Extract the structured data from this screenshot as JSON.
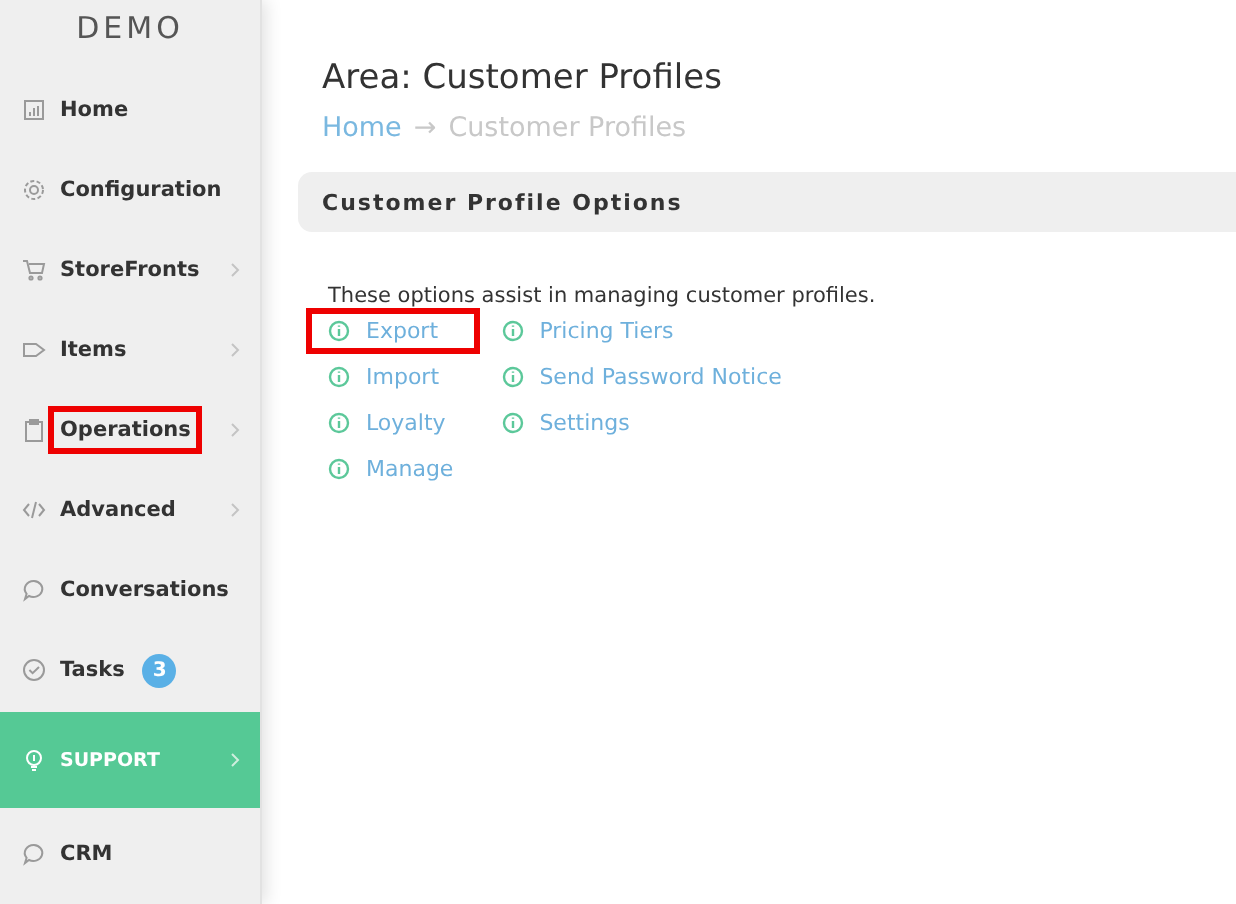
{
  "sidebar": {
    "logo": "DEMO",
    "items": [
      {
        "label": "Home",
        "has_submenu": false,
        "selected": false,
        "highlighted": false
      },
      {
        "label": "Configuration",
        "has_submenu": false,
        "selected": false,
        "highlighted": false
      },
      {
        "label": "StoreFronts",
        "has_submenu": true,
        "selected": false,
        "highlighted": false
      },
      {
        "label": "Items",
        "has_submenu": true,
        "selected": false,
        "highlighted": false
      },
      {
        "label": "Operations",
        "has_submenu": true,
        "selected": false,
        "highlighted": true
      },
      {
        "label": "Advanced",
        "has_submenu": true,
        "selected": false,
        "highlighted": false
      },
      {
        "label": "Conversations",
        "has_submenu": false,
        "selected": false,
        "highlighted": false
      },
      {
        "label": "Tasks",
        "has_submenu": false,
        "selected": false,
        "highlighted": false,
        "badge": "3"
      },
      {
        "label": "SUPPORT",
        "has_submenu": true,
        "selected": true,
        "highlighted": false
      },
      {
        "label": "CRM",
        "has_submenu": false,
        "selected": false,
        "highlighted": false
      }
    ]
  },
  "page": {
    "title": "Area: Customer Profiles",
    "breadcrumb": [
      {
        "label": "Home",
        "link": true
      },
      {
        "label": "→",
        "link": false
      },
      {
        "label": "Customer Profiles",
        "link": false
      }
    ]
  },
  "panel": {
    "title": "Customer Profile Options",
    "description": "These options assist in managing customer profiles.",
    "link_columns": [
      [
        {
          "label": "Export",
          "highlighted": true
        },
        {
          "label": "Import",
          "highlighted": false
        },
        {
          "label": "Loyalty",
          "highlighted": false
        },
        {
          "label": "Manage",
          "highlighted": false
        }
      ],
      [
        {
          "label": "Pricing Tiers",
          "highlighted": false
        },
        {
          "label": "Send Password Notice",
          "highlighted": false
        },
        {
          "label": "Settings",
          "highlighted": false
        }
      ]
    ]
  }
}
